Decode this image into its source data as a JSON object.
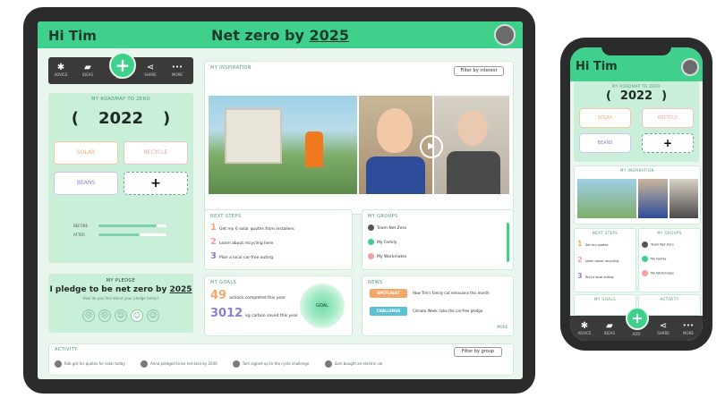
{
  "tablet": {
    "greeting": "Hi Tim",
    "title_prefix": "Net zero by ",
    "title_year": "2025",
    "toolbar": [
      {
        "icon": "asterisk-icon",
        "glyph": "✱",
        "label": "ADVICE"
      },
      {
        "icon": "folder-icon",
        "glyph": "▰",
        "label": "IDEAS"
      },
      {
        "icon": "plus-icon",
        "glyph": "+",
        "label": "ADD"
      },
      {
        "icon": "share-icon",
        "glyph": "⋖",
        "label": "SHARE"
      },
      {
        "icon": "more-icon",
        "glyph": "•••",
        "label": "MORE"
      }
    ],
    "roadmap": {
      "label": "MY ROADMAP TO ZERO",
      "prev": "(",
      "year": "2022",
      "next": ")",
      "options": [
        "SOLAR",
        "RECYCLE",
        "BEANS"
      ],
      "add": "+",
      "sliders": [
        {
          "label": "BEFORE",
          "value": 0.85
        },
        {
          "label": "AFTER",
          "value": 0.6
        }
      ]
    },
    "pledge": {
      "label": "MY PLEDGE",
      "text_prefix": "I pledge to be net zero by ",
      "year": "2025",
      "sub": "How do you feel about your pledge today?",
      "faces": [
        "☹",
        "☹",
        "☺",
        "☺",
        "☺"
      ]
    },
    "video": {
      "label": "MY INSPIRATION",
      "button": "Filter by interest"
    },
    "next_steps": {
      "label": "NEXT STEPS",
      "items": [
        {
          "n": "1",
          "text": "Get my 6 solar quotes from installers"
        },
        {
          "n": "2",
          "text": "Learn about recycling here"
        },
        {
          "n": "3",
          "text": "Plan a local car-free outing"
        }
      ]
    },
    "my_groups": {
      "label": "MY GROUPS",
      "items": [
        {
          "name": "Team Net Zero",
          "color": "#555555"
        },
        {
          "name": "My Family",
          "color": "#3fd18c"
        },
        {
          "name": "My Workmates",
          "color": "#f2a0a0"
        }
      ]
    },
    "my_goals": {
      "label": "MY GOALS",
      "stats": [
        {
          "value": "49",
          "text": "actions completed this year",
          "color": "#f2a76b"
        },
        {
          "value": "3012",
          "text": "kg carbon saved this year",
          "color": "#8a7fd0"
        }
      ],
      "ring_label": "GOAL"
    },
    "news": {
      "label": "NEWS",
      "items": [
        {
          "tag": "SPOTLIGHT",
          "tag_color": "#f2a76b",
          "text": "How Tim's family cut emissions this month"
        },
        {
          "tag": "CHALLENGE",
          "tag_color": "#5bc0d6",
          "text": "Climate Week: take the car-free pledge"
        }
      ],
      "more": "MORE"
    },
    "activity": {
      "label": "ACTIVITY",
      "button": "Filter by group",
      "items": [
        "Rob got his quotes for solar today",
        "Anna pledged to be net zero by 2030",
        "Tom signed up to the cycle challenge",
        "Sam bought an electric car"
      ]
    }
  },
  "phone": {
    "greeting": "Hi Tim",
    "roadmap_label": "MY ROADMAP TO ZERO",
    "prev": "(",
    "year": "2022",
    "next": ")",
    "options": [
      "SOLAR",
      "RECYCLE",
      "BEANS"
    ],
    "add": "+",
    "video_label": "MY INSPIRATION",
    "next_label": "NEXT STEPS",
    "next_items": [
      {
        "n": "1",
        "text": "Get my quotes"
      },
      {
        "n": "2",
        "text": "Learn about recycling"
      },
      {
        "n": "3",
        "text": "Find a local outing"
      }
    ],
    "groups_label": "MY GROUPS",
    "groups": [
      {
        "name": "Team Net Zero",
        "color": "#555555"
      },
      {
        "name": "My Family",
        "color": "#3fd18c"
      },
      {
        "name": "My Workmates",
        "color": "#f2a0a0"
      }
    ],
    "goals_label": "MY GOALS",
    "activity_label": "ACTIVITY",
    "nav": [
      {
        "icon": "asterisk-icon",
        "glyph": "✱",
        "label": "ADVICE"
      },
      {
        "icon": "folder-icon",
        "glyph": "▰",
        "label": "IDEAS"
      },
      {
        "icon": "plus-icon",
        "glyph": "+",
        "label": "ADD"
      },
      {
        "icon": "share-icon",
        "glyph": "⋖",
        "label": "SHARE"
      },
      {
        "icon": "more-icon",
        "glyph": "•••",
        "label": "MORE"
      }
    ]
  },
  "colors": {
    "accent": "#3fd18c",
    "panel": "#c9efd9",
    "background": "#e8f6ee",
    "frame": "#2b2b2b",
    "orange": "#f2a76b"
  }
}
